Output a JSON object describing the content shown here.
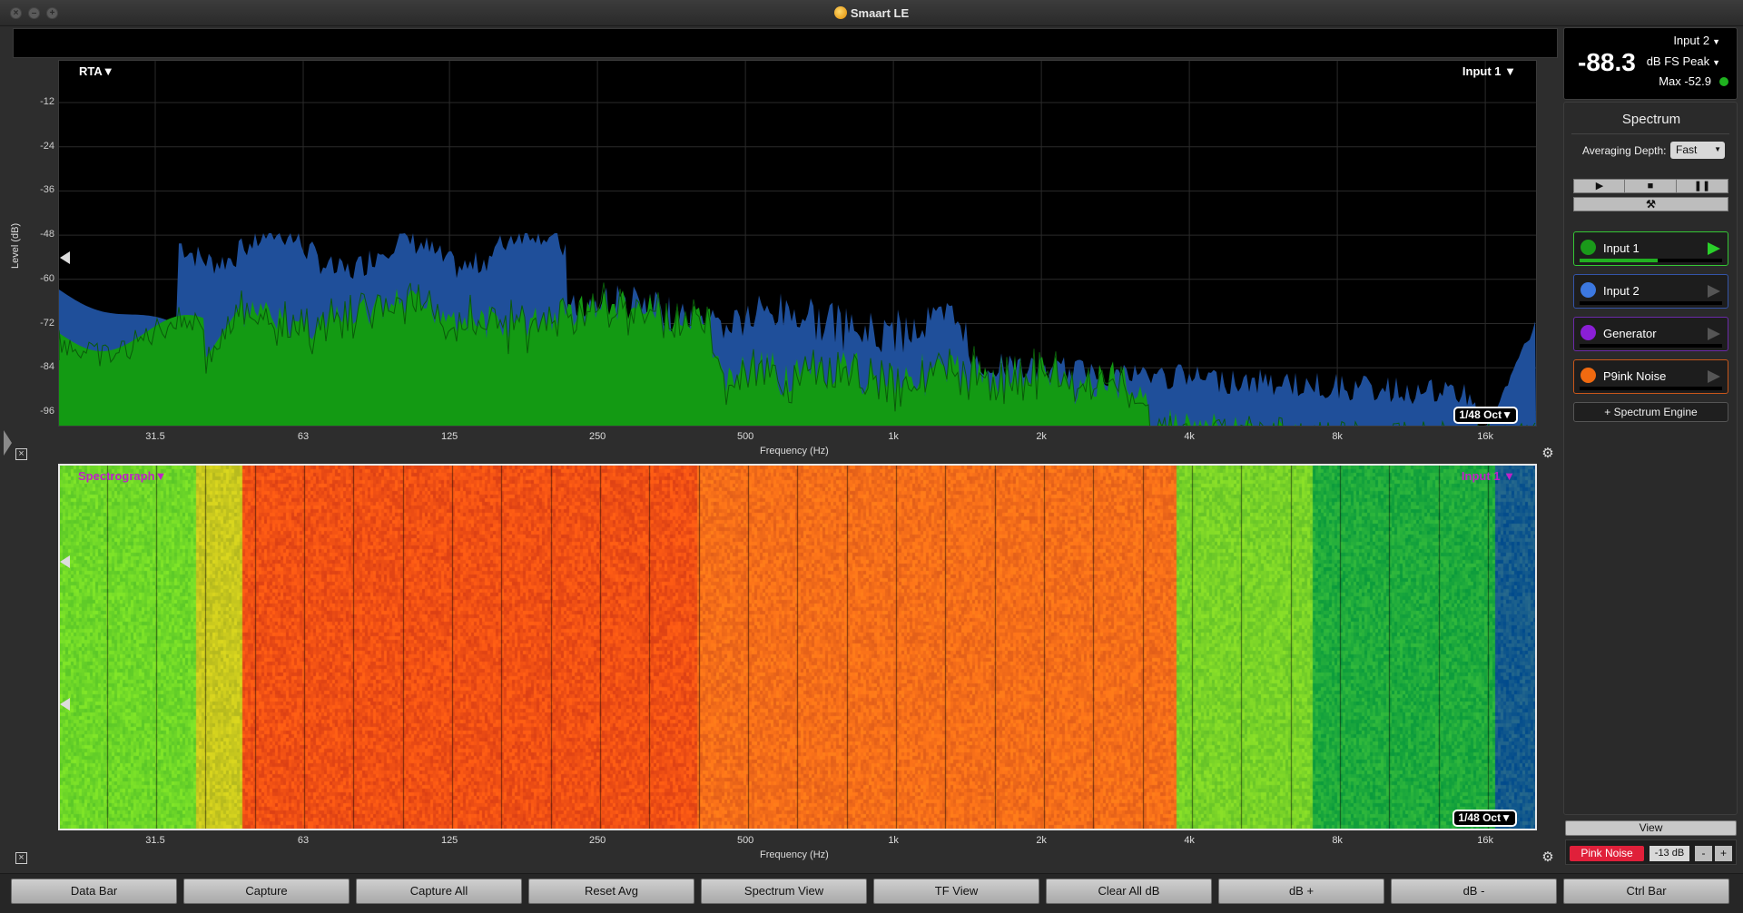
{
  "app": {
    "title": "Smaart LE"
  },
  "rta": {
    "tag": "RTA",
    "input_tag": "Input 1",
    "ylabel": "Level (dB)",
    "xlabel": "Frequency (Hz)",
    "y_ticks": [
      "-12",
      "-24",
      "-36",
      "-48",
      "-60",
      "-72",
      "-84",
      "-96"
    ],
    "x_ticks": [
      "31.5",
      "63",
      "125",
      "250",
      "500",
      "1k",
      "2k",
      "4k",
      "8k",
      "16k"
    ],
    "oct": "1/48 Oct"
  },
  "spectrograph": {
    "tag": "Spectrograph",
    "input_tag": "Input 1",
    "xlabel": "Frequency (Hz)",
    "x_ticks": [
      "31.5",
      "63",
      "125",
      "250",
      "500",
      "1k",
      "2k",
      "4k",
      "8k",
      "16k"
    ],
    "oct": "1/48 Oct"
  },
  "meter": {
    "value": "-88.3",
    "input": "Input 2",
    "unit": "dB FS Peak",
    "max": "Max -52.9",
    "status_color": "#1fb21f"
  },
  "spectrum_panel": {
    "title": "Spectrum",
    "averaging_label": "Averaging Depth:",
    "averaging_value": "Fast",
    "transport": {
      "play": "▶",
      "stop": "■",
      "pause": "❚❚",
      "tools": "⚒"
    },
    "measurements": [
      {
        "name": "Input 1",
        "color": "#1a9a1a",
        "border": "#35c635",
        "level": 0.55
      },
      {
        "name": "Input 2",
        "color": "#3c78e0",
        "border": "#3454a8",
        "level": 0
      },
      {
        "name": "Generator",
        "color": "#8b1fd6",
        "border": "#6b2aa8",
        "level": 0
      },
      {
        "name": "P9ink Noise",
        "color": "#f06a10",
        "border": "#c8561a",
        "level": 0
      }
    ],
    "add_engine": "+ Spectrum Engine"
  },
  "view_button": "View",
  "generator": {
    "button": "Pink Noise",
    "level": "-13 dB",
    "minus": "-",
    "plus": "+",
    "color": "#e0203a"
  },
  "bottom_buttons": [
    "Data Bar",
    "Capture",
    "Capture All",
    "Reset Avg",
    "Spectrum View",
    "TF View",
    "Clear All dB",
    "dB +",
    "dB -",
    "Ctrl Bar"
  ]
}
